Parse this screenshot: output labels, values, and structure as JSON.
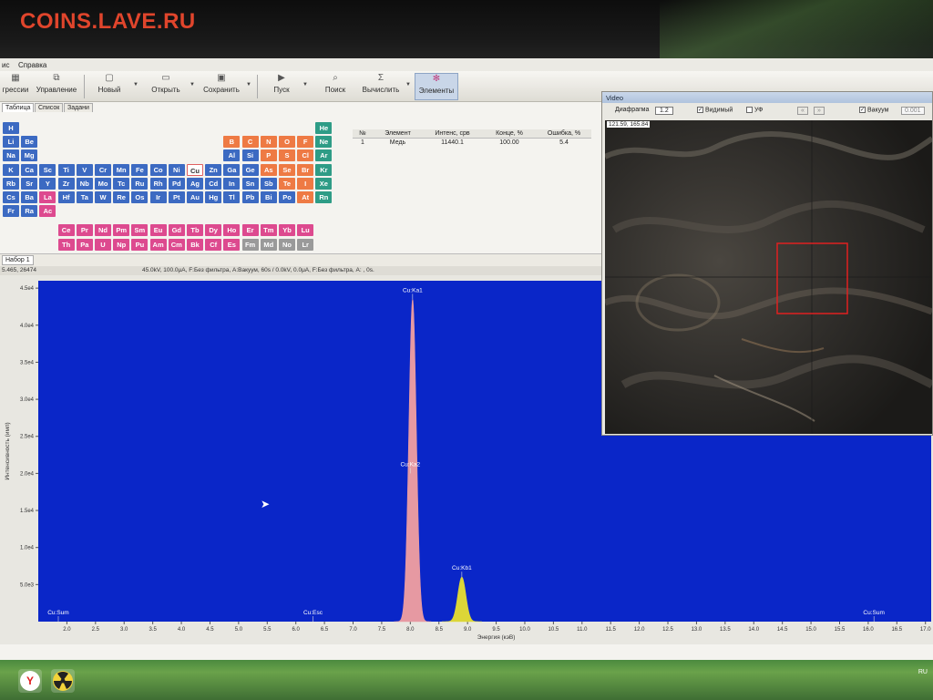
{
  "watermark": "COINS.LAVE.RU",
  "menu": {
    "item1": "ис",
    "item2": "Справка"
  },
  "toolbar": {
    "b1": "грессии",
    "b2": "Управление",
    "b3": "Новый",
    "b4": "Открыть",
    "b5": "Сохранить",
    "b6": "Пуск",
    "b7": "Поиск",
    "b8": "Вычислить",
    "b9": "Элементы"
  },
  "left_tabs": {
    "t1": "Таблица",
    "t2": "Список",
    "t3": "Задани"
  },
  "periodic_table": {
    "rows": [
      {
        "elements": [
          {
            "sym": "H",
            "col": 0,
            "row": 0,
            "cat": "blue"
          },
          {
            "sym": "He",
            "col": 17,
            "row": 0,
            "cat": "teal"
          }
        ]
      },
      {
        "elements": [
          {
            "sym": "Li",
            "col": 0,
            "row": 1,
            "cat": "blue"
          },
          {
            "sym": "Be",
            "col": 1,
            "row": 1,
            "cat": "blue"
          },
          {
            "sym": "B",
            "col": 12,
            "row": 1,
            "cat": "orange"
          },
          {
            "sym": "C",
            "col": 13,
            "row": 1,
            "cat": "orange"
          },
          {
            "sym": "N",
            "col": 14,
            "row": 1,
            "cat": "orange"
          },
          {
            "sym": "O",
            "col": 15,
            "row": 1,
            "cat": "orange"
          },
          {
            "sym": "F",
            "col": 16,
            "row": 1,
            "cat": "orange"
          },
          {
            "sym": "Ne",
            "col": 17,
            "row": 1,
            "cat": "teal"
          }
        ]
      },
      {
        "elements": [
          {
            "sym": "Na",
            "col": 0,
            "row": 2,
            "cat": "blue"
          },
          {
            "sym": "Mg",
            "col": 1,
            "row": 2,
            "cat": "blue"
          },
          {
            "sym": "Al",
            "col": 12,
            "row": 2,
            "cat": "blue"
          },
          {
            "sym": "Si",
            "col": 13,
            "row": 2,
            "cat": "blue"
          },
          {
            "sym": "P",
            "col": 14,
            "row": 2,
            "cat": "orange"
          },
          {
            "sym": "S",
            "col": 15,
            "row": 2,
            "cat": "orange"
          },
          {
            "sym": "Cl",
            "col": 16,
            "row": 2,
            "cat": "orange"
          },
          {
            "sym": "Ar",
            "col": 17,
            "row": 2,
            "cat": "teal"
          }
        ]
      },
      {
        "elements": [
          {
            "sym": "K",
            "col": 0,
            "row": 3,
            "cat": "blue"
          },
          {
            "sym": "Ca",
            "col": 1,
            "row": 3,
            "cat": "blue"
          },
          {
            "sym": "Sc",
            "col": 2,
            "row": 3,
            "cat": "blue"
          },
          {
            "sym": "Ti",
            "col": 3,
            "row": 3,
            "cat": "blue"
          },
          {
            "sym": "V",
            "col": 4,
            "row": 3,
            "cat": "blue"
          },
          {
            "sym": "Cr",
            "col": 5,
            "row": 3,
            "cat": "blue"
          },
          {
            "sym": "Mn",
            "col": 6,
            "row": 3,
            "cat": "blue"
          },
          {
            "sym": "Fe",
            "col": 7,
            "row": 3,
            "cat": "blue"
          },
          {
            "sym": "Co",
            "col": 8,
            "row": 3,
            "cat": "blue"
          },
          {
            "sym": "Ni",
            "col": 9,
            "row": 3,
            "cat": "blue"
          },
          {
            "sym": "Cu",
            "col": 10,
            "row": 3,
            "cat": "sel"
          },
          {
            "sym": "Zn",
            "col": 11,
            "row": 3,
            "cat": "blue"
          },
          {
            "sym": "Ga",
            "col": 12,
            "row": 3,
            "cat": "blue"
          },
          {
            "sym": "Ge",
            "col": 13,
            "row": 3,
            "cat": "blue"
          },
          {
            "sym": "As",
            "col": 14,
            "row": 3,
            "cat": "orange"
          },
          {
            "sym": "Se",
            "col": 15,
            "row": 3,
            "cat": "orange"
          },
          {
            "sym": "Br",
            "col": 16,
            "row": 3,
            "cat": "orange"
          },
          {
            "sym": "Kr",
            "col": 17,
            "row": 3,
            "cat": "teal"
          }
        ]
      },
      {
        "elements": [
          {
            "sym": "Rb",
            "col": 0,
            "row": 4,
            "cat": "blue"
          },
          {
            "sym": "Sr",
            "col": 1,
            "row": 4,
            "cat": "blue"
          },
          {
            "sym": "Y",
            "col": 2,
            "row": 4,
            "cat": "blue"
          },
          {
            "sym": "Zr",
            "col": 3,
            "row": 4,
            "cat": "blue"
          },
          {
            "sym": "Nb",
            "col": 4,
            "row": 4,
            "cat": "blue"
          },
          {
            "sym": "Mo",
            "col": 5,
            "row": 4,
            "cat": "blue"
          },
          {
            "sym": "Tc",
            "col": 6,
            "row": 4,
            "cat": "blue"
          },
          {
            "sym": "Ru",
            "col": 7,
            "row": 4,
            "cat": "blue"
          },
          {
            "sym": "Rh",
            "col": 8,
            "row": 4,
            "cat": "blue"
          },
          {
            "sym": "Pd",
            "col": 9,
            "row": 4,
            "cat": "blue"
          },
          {
            "sym": "Ag",
            "col": 10,
            "row": 4,
            "cat": "blue"
          },
          {
            "sym": "Cd",
            "col": 11,
            "row": 4,
            "cat": "blue"
          },
          {
            "sym": "In",
            "col": 12,
            "row": 4,
            "cat": "blue"
          },
          {
            "sym": "Sn",
            "col": 13,
            "row": 4,
            "cat": "blue"
          },
          {
            "sym": "Sb",
            "col": 14,
            "row": 4,
            "cat": "blue"
          },
          {
            "sym": "Te",
            "col": 15,
            "row": 4,
            "cat": "orange"
          },
          {
            "sym": "I",
            "col": 16,
            "row": 4,
            "cat": "orange"
          },
          {
            "sym": "Xe",
            "col": 17,
            "row": 4,
            "cat": "teal"
          }
        ]
      },
      {
        "elements": [
          {
            "sym": "Cs",
            "col": 0,
            "row": 5,
            "cat": "blue"
          },
          {
            "sym": "Ba",
            "col": 1,
            "row": 5,
            "cat": "blue"
          },
          {
            "sym": "La",
            "col": 2,
            "row": 5,
            "cat": "pink"
          },
          {
            "sym": "Hf",
            "col": 3,
            "row": 5,
            "cat": "blue"
          },
          {
            "sym": "Ta",
            "col": 4,
            "row": 5,
            "cat": "blue"
          },
          {
            "sym": "W",
            "col": 5,
            "row": 5,
            "cat": "blue"
          },
          {
            "sym": "Re",
            "col": 6,
            "row": 5,
            "cat": "blue"
          },
          {
            "sym": "Os",
            "col": 7,
            "row": 5,
            "cat": "blue"
          },
          {
            "sym": "Ir",
            "col": 8,
            "row": 5,
            "cat": "blue"
          },
          {
            "sym": "Pt",
            "col": 9,
            "row": 5,
            "cat": "blue"
          },
          {
            "sym": "Au",
            "col": 10,
            "row": 5,
            "cat": "blue"
          },
          {
            "sym": "Hg",
            "col": 11,
            "row": 5,
            "cat": "blue"
          },
          {
            "sym": "Tl",
            "col": 12,
            "row": 5,
            "cat": "blue"
          },
          {
            "sym": "Pb",
            "col": 13,
            "row": 5,
            "cat": "blue"
          },
          {
            "sym": "Bi",
            "col": 14,
            "row": 5,
            "cat": "blue"
          },
          {
            "sym": "Po",
            "col": 15,
            "row": 5,
            "cat": "blue"
          },
          {
            "sym": "At",
            "col": 16,
            "row": 5,
            "cat": "orange"
          },
          {
            "sym": "Rn",
            "col": 17,
            "row": 5,
            "cat": "teal"
          }
        ]
      },
      {
        "elements": [
          {
            "sym": "Fr",
            "col": 0,
            "row": 6,
            "cat": "blue"
          },
          {
            "sym": "Ra",
            "col": 1,
            "row": 6,
            "cat": "blue"
          },
          {
            "sym": "Ac",
            "col": 2,
            "row": 6,
            "cat": "pink"
          }
        ]
      },
      {
        "elements": [
          {
            "sym": "Ce",
            "col": 3,
            "row": 7.4,
            "cat": "pink"
          },
          {
            "sym": "Pr",
            "col": 4,
            "row": 7.4,
            "cat": "pink"
          },
          {
            "sym": "Nd",
            "col": 5,
            "row": 7.4,
            "cat": "pink"
          },
          {
            "sym": "Pm",
            "col": 6,
            "row": 7.4,
            "cat": "pink"
          },
          {
            "sym": "Sm",
            "col": 7,
            "row": 7.4,
            "cat": "pink"
          },
          {
            "sym": "Eu",
            "col": 8,
            "row": 7.4,
            "cat": "pink"
          },
          {
            "sym": "Gd",
            "col": 9,
            "row": 7.4,
            "cat": "pink"
          },
          {
            "sym": "Tb",
            "col": 10,
            "row": 7.4,
            "cat": "pink"
          },
          {
            "sym": "Dy",
            "col": 11,
            "row": 7.4,
            "cat": "pink"
          },
          {
            "sym": "Ho",
            "col": 12,
            "row": 7.4,
            "cat": "pink"
          },
          {
            "sym": "Er",
            "col": 13,
            "row": 7.4,
            "cat": "pink"
          },
          {
            "sym": "Tm",
            "col": 14,
            "row": 7.4,
            "cat": "pink"
          },
          {
            "sym": "Yb",
            "col": 15,
            "row": 7.4,
            "cat": "pink"
          },
          {
            "sym": "Lu",
            "col": 16,
            "row": 7.4,
            "cat": "pink"
          }
        ]
      },
      {
        "elements": [
          {
            "sym": "Th",
            "col": 3,
            "row": 8.4,
            "cat": "pink"
          },
          {
            "sym": "Pa",
            "col": 4,
            "row": 8.4,
            "cat": "pink"
          },
          {
            "sym": "U",
            "col": 5,
            "row": 8.4,
            "cat": "pink"
          },
          {
            "sym": "Np",
            "col": 6,
            "row": 8.4,
            "cat": "pink"
          },
          {
            "sym": "Pu",
            "col": 7,
            "row": 8.4,
            "cat": "pink"
          },
          {
            "sym": "Am",
            "col": 8,
            "row": 8.4,
            "cat": "pink"
          },
          {
            "sym": "Cm",
            "col": 9,
            "row": 8.4,
            "cat": "pink"
          },
          {
            "sym": "Bk",
            "col": 10,
            "row": 8.4,
            "cat": "pink"
          },
          {
            "sym": "Cf",
            "col": 11,
            "row": 8.4,
            "cat": "pink"
          },
          {
            "sym": "Es",
            "col": 12,
            "row": 8.4,
            "cat": "pink"
          },
          {
            "sym": "Fm",
            "col": 13,
            "row": 8.4,
            "cat": "gray"
          },
          {
            "sym": "Md",
            "col": 14,
            "row": 8.4,
            "cat": "gray"
          },
          {
            "sym": "No",
            "col": 15,
            "row": 8.4,
            "cat": "gray"
          },
          {
            "sym": "Lr",
            "col": 16,
            "row": 8.4,
            "cat": "gray"
          }
        ]
      }
    ]
  },
  "results": {
    "headers": [
      "№",
      "Элемент",
      "Интенс, срв",
      "Конце, %",
      "Ошибка, %"
    ],
    "rows": [
      [
        "1",
        "Медь",
        "11440.1",
        "100.00",
        "5.4"
      ]
    ]
  },
  "spectrum": {
    "tab_label": "Набор 1",
    "cursor_readout": "5.465, 26474",
    "conditions": "45.0kV, 100.0μA, F:Без фильтра, A:Вакуум, 60s  /  0.0kV, 0.0μA, F:Без фильтра, A: , 0s."
  },
  "video": {
    "title": "Video",
    "aperture_label": "Диафрагма",
    "aperture_value": "1.2",
    "check_visible": "Видимый",
    "check_uv": "УФ",
    "check_vacuum": "Вакуум",
    "vacuum_value": "0.001",
    "coords": "121.59, 165.84"
  },
  "taskbar": {
    "lang": "RU"
  },
  "chart_data": {
    "type": "line",
    "title": "",
    "xlabel": "Энергия (кэВ)",
    "ylabel": "Интенсивность (имп)",
    "xlim": [
      1.5,
      17.1
    ],
    "ylim": [
      0,
      46000
    ],
    "x_ticks": [
      "2.0",
      "2.5",
      "3.0",
      "3.5",
      "4.0",
      "4.5",
      "5.0",
      "5.5",
      "6.0",
      "6.5",
      "7.0",
      "7.5",
      "8.0",
      "8.5",
      "9.0",
      "9.5",
      "10.0",
      "10.5",
      "11.0",
      "11.5",
      "12.0",
      "12.5",
      "13.0",
      "13.5",
      "14.0",
      "14.5",
      "15.0",
      "15.5",
      "16.0",
      "16.5",
      "17.0"
    ],
    "y_ticks": [
      "5.0e3",
      "1.0e4",
      "1.5e4",
      "2.0e4",
      "2.5e4",
      "3.0e4",
      "3.5e4",
      "4.0e4",
      "4.5e4"
    ],
    "background_color": "#0a26c8",
    "series": [
      {
        "name": "Cu Ka",
        "color": "#f2a0a0",
        "peak_x": 8.04,
        "peak_y": 43500,
        "sigma": 0.065
      },
      {
        "name": "Cu Kb",
        "color": "#e8e030",
        "peak_x": 8.9,
        "peak_y": 6000,
        "sigma": 0.07
      }
    ],
    "annotations": [
      {
        "label": "Cu:Ka1",
        "x": 8.04,
        "y": 43500
      },
      {
        "label": "Cu:Ka2",
        "x": 8.0,
        "y": 20000
      },
      {
        "label": "Cu:Kb1",
        "x": 8.9,
        "y": 6000
      },
      {
        "label": "Cu:Sum",
        "x": 1.85,
        "y": 0
      },
      {
        "label": "Cu:Esc",
        "x": 6.3,
        "y": 0
      },
      {
        "label": "Cu:Sum",
        "x": 16.1,
        "y": 0
      }
    ]
  }
}
